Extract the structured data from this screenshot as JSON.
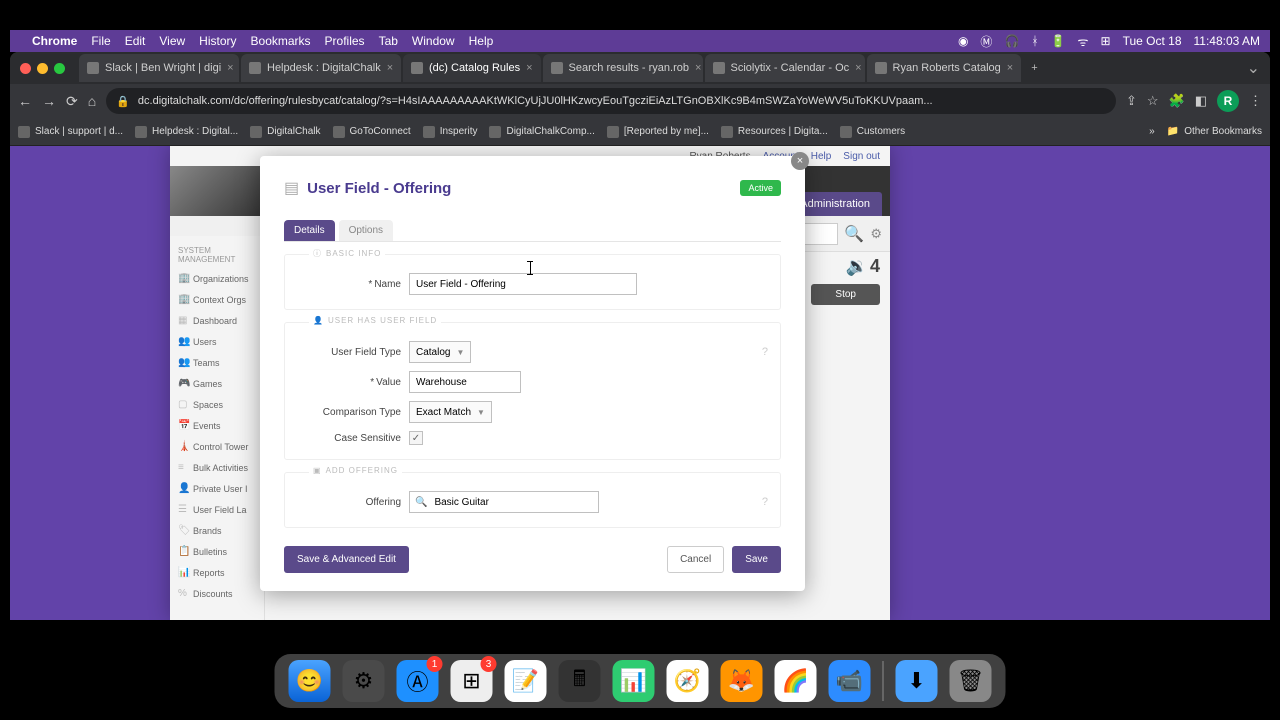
{
  "menubar": {
    "app": "Chrome",
    "items": [
      "File",
      "Edit",
      "View",
      "History",
      "Bookmarks",
      "Profiles",
      "Tab",
      "Window",
      "Help"
    ],
    "date": "Tue Oct 18",
    "time": "11:48:03 AM"
  },
  "tabs": [
    {
      "label": "Slack | Ben Wright | digi"
    },
    {
      "label": "Helpdesk : DigitalChalk"
    },
    {
      "label": "(dc) Catalog Rules"
    },
    {
      "label": "Search results - ryan.rob"
    },
    {
      "label": "Sciolytix - Calendar - Oc"
    },
    {
      "label": "Ryan Roberts Catalog"
    }
  ],
  "url": "dc.digitalchalk.com/dc/offering/rulesbycat/catalog/?s=H4sIAAAAAAAAAKtWKlCyUjJU0lHKzwcyEouTgcziEiAzLTGnOBXlKc9B4mSWZaYoWeWV5uToKKUVpaam...",
  "profile_letter": "R",
  "bookmarks": [
    "Slack | support | d...",
    "Helpdesk : Digital...",
    "DigitalChalk",
    "GoToConnect",
    "Insperity",
    "DigitalChalkComp...",
    "[Reported by me]...",
    "Resources | Digita...",
    "Customers"
  ],
  "other_bookmarks": "Other Bookmarks",
  "apphdr": {
    "user": "Ryan Roberts",
    "account": "Account",
    "help": "Help",
    "signout": "Sign out"
  },
  "admin_label": "Administration",
  "count": "4",
  "stop_label": "Stop",
  "sidebar": {
    "heading": "System Management",
    "items": [
      "Organizations",
      "Context Orgs",
      "Dashboard",
      "Users",
      "Teams",
      "Games",
      "Spaces",
      "Events",
      "Control Tower",
      "Bulk Activities",
      "Private User I",
      "User Field La",
      "Brands",
      "Bulletins",
      "Reports",
      "Discounts"
    ]
  },
  "modal": {
    "title": "User Field - Offering",
    "status": "Active",
    "tabs": {
      "details": "Details",
      "options": "Options"
    },
    "sections": {
      "basic": "BASIC INFO",
      "userhas": "USER HAS USER FIELD",
      "addoff": "ADD OFFERING"
    },
    "fields": {
      "name_label": "Name",
      "name_value": "User Field - Offering",
      "type_label": "User Field Type",
      "type_value": "Catalog",
      "value_label": "Value",
      "value_value": "Warehouse",
      "comp_label": "Comparison Type",
      "comp_value": "Exact Match",
      "case_label": "Case Sensitive",
      "offering_label": "Offering",
      "offering_value": "Basic Guitar"
    },
    "buttons": {
      "adv": "Save & Advanced Edit",
      "cancel": "Cancel",
      "save": "Save"
    }
  },
  "dock_badges": {
    "2": "1",
    "3": "3"
  }
}
